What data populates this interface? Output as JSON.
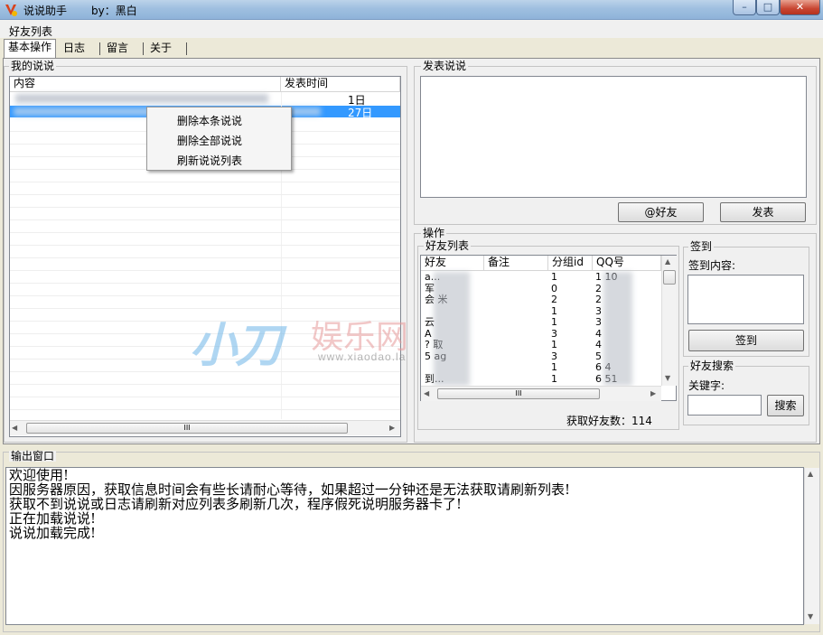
{
  "window": {
    "title": "说说助手",
    "author": "by：黑白",
    "controls": {
      "minimize": "–",
      "maximize": "□",
      "close": "✕"
    }
  },
  "menu": {
    "friend_list": "好友列表"
  },
  "tabs": [
    {
      "label": "基本操作",
      "active": true
    },
    {
      "label": "日志",
      "active": false
    },
    {
      "label": "留言",
      "active": false
    },
    {
      "label": "关于",
      "active": false
    }
  ],
  "my_posts": {
    "group_label": "我的说说",
    "columns": [
      "内容",
      "发表时间"
    ],
    "rows": [
      {
        "content": "",
        "time": "1日"
      },
      {
        "content": "",
        "time": "27日"
      }
    ],
    "hscroll_grip": "III"
  },
  "context_menu": {
    "items": [
      "删除本条说说",
      "删除全部说说",
      "刷新说说列表"
    ]
  },
  "publish": {
    "group_label": "发表说说",
    "text": "",
    "at_friend_button": "@好友",
    "publish_button": "发表"
  },
  "operations": {
    "group_label": "操作",
    "friend_list": {
      "group_label": "好友列表",
      "columns": [
        "好友",
        "备注",
        "分组id",
        "QQ号"
      ],
      "rows": [
        {
          "name": "a...",
          "note": "",
          "group": "1",
          "qq": "1 10"
        },
        {
          "name": "军",
          "note": "",
          "group": "0",
          "qq": "2"
        },
        {
          "name": "会 米",
          "note": "",
          "group": "2",
          "qq": "2"
        },
        {
          "name": "",
          "note": "",
          "group": "1",
          "qq": "3"
        },
        {
          "name": "云",
          "note": "",
          "group": "1",
          "qq": "3"
        },
        {
          "name": "A",
          "note": "",
          "group": "3",
          "qq": "4"
        },
        {
          "name": "? 取",
          "note": "",
          "group": "1",
          "qq": "4"
        },
        {
          "name": "5 ag",
          "note": "",
          "group": "3",
          "qq": "5"
        },
        {
          "name": "",
          "note": "",
          "group": "1",
          "qq": "6 4"
        },
        {
          "name": "到...",
          "note": "",
          "group": "1",
          "qq": "6 51"
        }
      ],
      "hscroll_grip": "III",
      "count_text": "获取好友数：114"
    },
    "checkin": {
      "group_label": "签到",
      "content_label": "签到内容:",
      "content_value": "",
      "button": "签到"
    },
    "search": {
      "group_label": "好友搜索",
      "keyword_label": "关键字:",
      "keyword_value": "",
      "button": "搜索"
    }
  },
  "output": {
    "group_label": "输出窗口",
    "lines": [
      "欢迎使用!",
      "因服务器原因，获取信息时间会有些长请耐心等待，如果超过一分钟还是无法获取请刷新列表!",
      "获取不到说说或日志请刷新对应列表多刷新几次，程序假死说明服务器卡了!",
      "正在加载说说!",
      "说说加载完成!"
    ]
  },
  "watermark": {
    "big": "小刀娱乐网",
    "url": "www.xiaodao.la"
  }
}
